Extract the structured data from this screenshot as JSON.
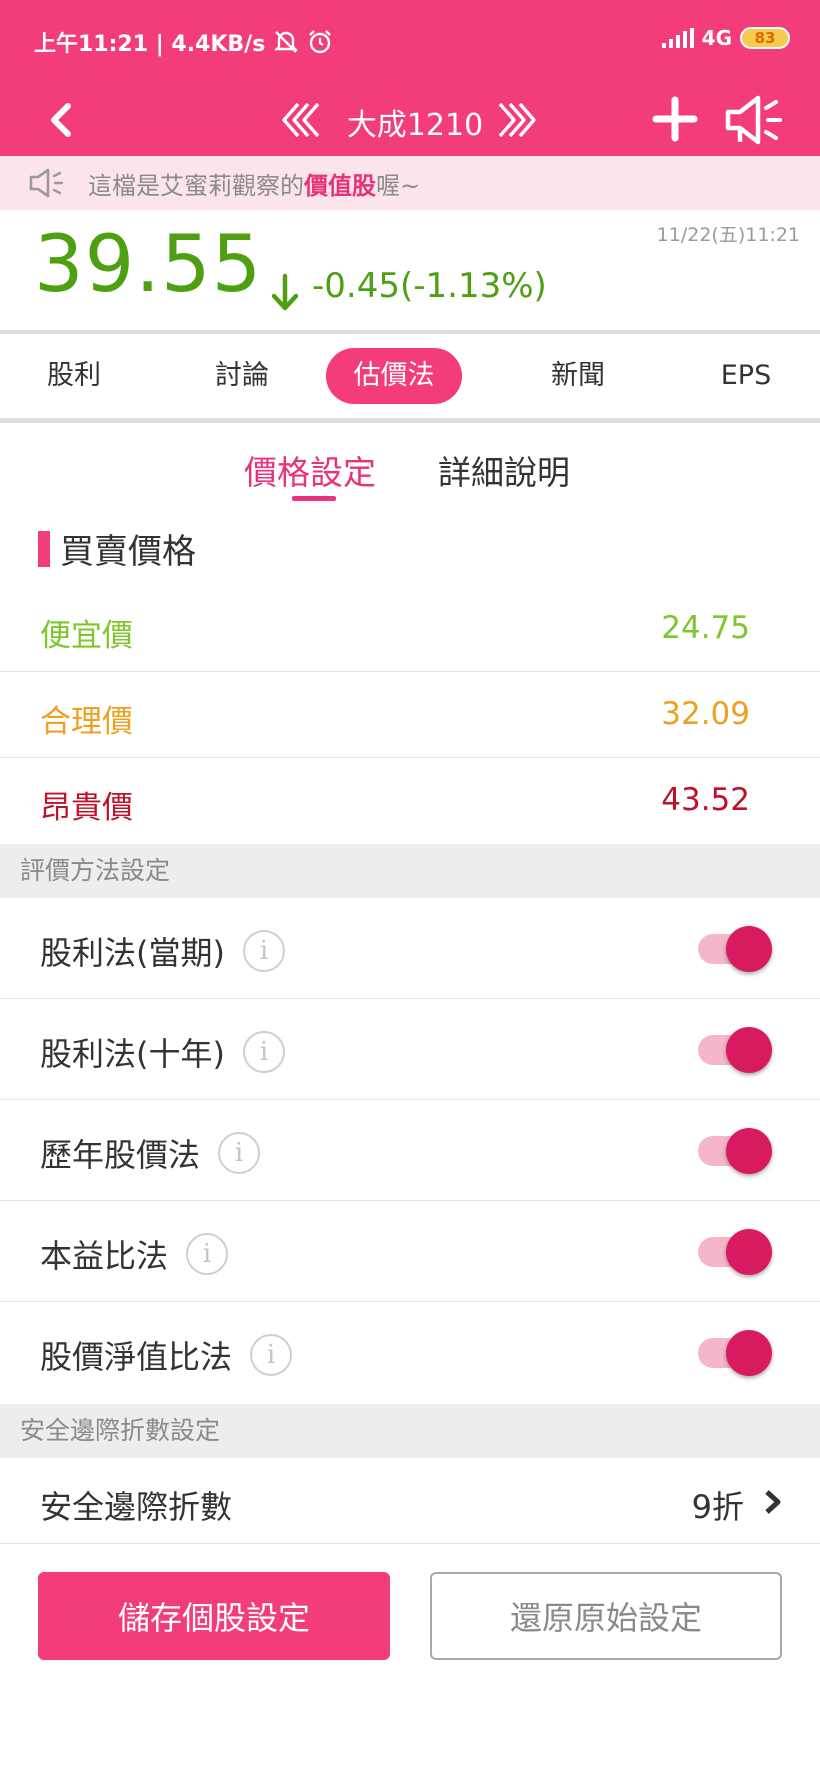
{
  "status_bar": {
    "time_speed": "上午11:21 | 4.4KB/s",
    "network": "4G",
    "battery": "83"
  },
  "nav": {
    "title": "大成1210"
  },
  "notice": {
    "prefix": "這檔是艾蜜莉觀察的",
    "highlight": "價值股",
    "suffix": "喔~"
  },
  "quote": {
    "price": "39.55",
    "change": "-0.45(-1.13%)",
    "timestamp": "11/22(五)11:21",
    "color": "#4ea012"
  },
  "tabs": [
    {
      "label": "股利"
    },
    {
      "label": "討論"
    },
    {
      "label": "估價法"
    },
    {
      "label": "新聞"
    },
    {
      "label": "EPS"
    }
  ],
  "active_tab": "估價法",
  "sub_tabs": [
    {
      "label": "價格設定"
    },
    {
      "label": "詳細說明"
    }
  ],
  "price_section": {
    "title": "買賣價格",
    "rows": [
      {
        "label": "便宜價",
        "value": "24.75",
        "color": "#7cc82c"
      },
      {
        "label": "合理價",
        "value": "32.09",
        "color": "#f0a020"
      },
      {
        "label": "昂貴價",
        "value": "43.52",
        "color": "#c0102a"
      }
    ]
  },
  "method_section": {
    "header": "評價方法設定",
    "items": [
      {
        "label": "股利法(當期)",
        "enabled": true
      },
      {
        "label": "股利法(十年)",
        "enabled": true
      },
      {
        "label": "歷年股價法",
        "enabled": true
      },
      {
        "label": "本益比法",
        "enabled": true
      },
      {
        "label": "股價淨值比法",
        "enabled": true
      }
    ]
  },
  "safety_section": {
    "header": "安全邊際折數設定",
    "label": "安全邊際折數",
    "value": "9折"
  },
  "buttons": {
    "save": "儲存個股設定",
    "reset": "還原原始設定"
  },
  "colors": {
    "brand": "#f23c7c",
    "toggle_on": "#d81b60"
  }
}
